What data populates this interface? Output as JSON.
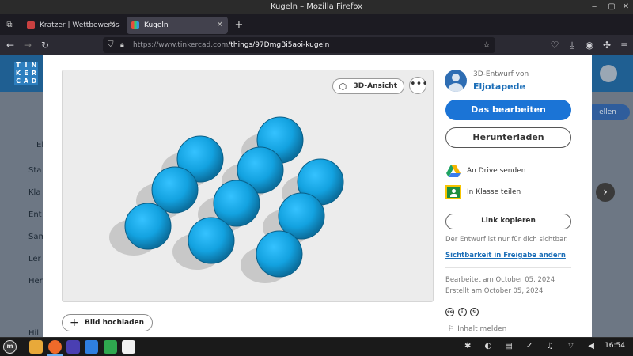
{
  "window": {
    "title": "Kugeln – Mozilla Firefox"
  },
  "tabs": [
    {
      "label": "Kratzer | Wettbewerbs-The",
      "active": false
    },
    {
      "label": "Kugeln",
      "active": true
    }
  ],
  "navbar": {
    "url_host": "https://www.tinkercad.com",
    "url_path": "/things/97DmgBi5aoi-kugeln"
  },
  "background_page": {
    "logo_letters": [
      "T",
      "I",
      "N",
      "K",
      "E",
      "R",
      "C",
      "A",
      "D"
    ],
    "sidebar_items": [
      "El",
      "Sta",
      "Kla",
      "Ent",
      "Sam",
      "Ler",
      "Her",
      "Hil"
    ],
    "edit_button_partial": "ellen"
  },
  "viewer": {
    "view_3d_label": "3D-Ansicht",
    "more_label": "•••",
    "sphere_color": "#1aa3e0",
    "upload_label": "Bild hochladen"
  },
  "panel": {
    "byline": "3D-Entwurf von",
    "author": "Eljotapede",
    "edit_label": "Das bearbeiten",
    "download_label": "Herunterladen",
    "drive_label": "An Drive senden",
    "classroom_label": "In Klasse teilen",
    "copy_link_label": "Link kopieren",
    "visibility_note": "Der Entwurf ist nur für dich sichtbar.",
    "visibility_link": "Sichtbarkeit in Freigabe ändern",
    "edited": "Bearbeitet am October 05, 2024",
    "created": "Erstellt am October 05, 2024",
    "report_label": "Inhalt melden",
    "accent_color": "#1b74d6"
  },
  "taskbar": {
    "clock": "16:54"
  }
}
